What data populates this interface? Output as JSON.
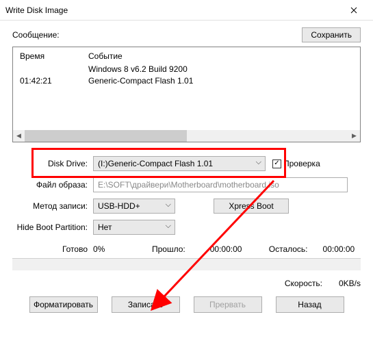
{
  "title": "Write Disk Image",
  "message_label": "Сообщение:",
  "save_btn": "Сохранить",
  "log": {
    "header_time": "Время",
    "header_event": "Событие",
    "rows": [
      {
        "time": "",
        "event": "Windows 8 v6.2 Build 9200"
      },
      {
        "time": "01:42:21",
        "event": "Generic-Compact Flash   1.01"
      }
    ]
  },
  "labels": {
    "disk_drive": "Disk Drive:",
    "image_file": "Файл образа:",
    "write_method": "Метод записи:",
    "hide_boot": "Hide Boot Partition:",
    "verify": "Проверка",
    "ready": "Готово",
    "elapsed": "Прошло:",
    "remaining": "Осталось:",
    "speed": "Скорость:"
  },
  "values": {
    "disk_drive": "(I:)Generic-Compact Flash   1.01",
    "image_file": "E:\\SOFT\\драйвери\\Motherboard\\motherboard.iso",
    "write_method": "USB-HDD+",
    "hide_boot": "Нет",
    "progress": "0%",
    "elapsed": "00:00:00",
    "remaining": "00:00:00",
    "speed": "0KB/s",
    "verify_checked": "✓"
  },
  "buttons": {
    "xpress": "Xpress Boot",
    "format": "Форматировать",
    "write": "Записать",
    "abort": "Прервать",
    "back": "Назад"
  }
}
